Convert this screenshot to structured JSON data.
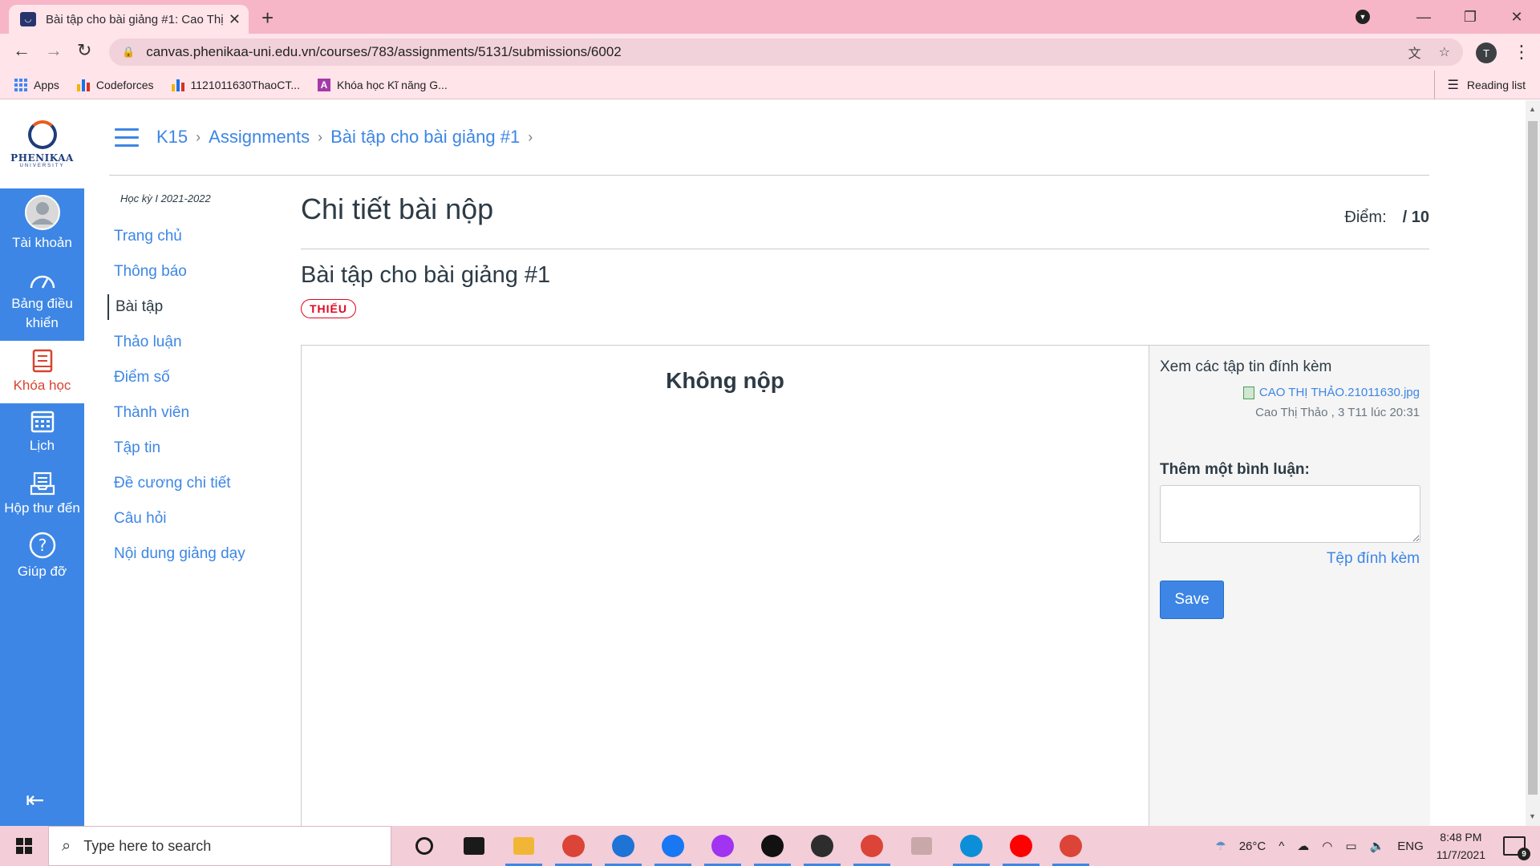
{
  "browser": {
    "tab_title": "Bài tập cho bài giảng #1: Cao Thị",
    "tab_close": "✕",
    "new_tab": "+",
    "url": "canvas.phenikaa-uni.edu.vn/courses/783/assignments/5131/submissions/6002",
    "profile_initial": "T",
    "bookmarks": [
      {
        "label": "Apps"
      },
      {
        "label": "Codeforces"
      },
      {
        "label": "1121011630ThaoCT..."
      },
      {
        "label": "Khóa học Kĩ năng G..."
      }
    ],
    "reading_list": "Reading list"
  },
  "global_nav": {
    "logo_text": "PHENIKAA",
    "logo_sub": "UNIVERSITY",
    "items": [
      {
        "label": "Tài khoản",
        "icon": "account-avatar-icon"
      },
      {
        "label": "Bảng điều khiển",
        "icon": "dashboard-gauge-icon"
      },
      {
        "label": "Khóa học",
        "icon": "courses-book-icon",
        "active": true
      },
      {
        "label": "Lịch",
        "icon": "calendar-icon"
      },
      {
        "label": "Hộp thư đến",
        "icon": "inbox-icon"
      },
      {
        "label": "Giúp đỡ",
        "icon": "help-question-icon"
      }
    ]
  },
  "breadcrumb": [
    {
      "label": "K15"
    },
    {
      "label": "Assignments"
    },
    {
      "label": "Bài tập cho bài giảng #1"
    }
  ],
  "course_nav": {
    "term": "Học kỳ I 2021-2022",
    "items": [
      {
        "label": "Trang chủ"
      },
      {
        "label": "Thông báo"
      },
      {
        "label": "Bài tập",
        "active": true
      },
      {
        "label": "Thảo luận"
      },
      {
        "label": "Điểm số"
      },
      {
        "label": "Thành viên"
      },
      {
        "label": "Tập tin"
      },
      {
        "label": "Đề cương chi tiết"
      },
      {
        "label": "Câu hỏi"
      },
      {
        "label": "Nội dung giảng dạy"
      }
    ]
  },
  "submission": {
    "page_title": "Chi tiết bài nộp",
    "score_label": "Điểm:",
    "score_value": "/ 10",
    "assignment_title": "Bài tập cho bài giảng #1",
    "status_badge": "THIẾU",
    "no_submission": "Không nộp",
    "attachments_title": "Xem các tập tin đính kèm",
    "attachment_file": "CAO THỊ THẢO.21011630.jpg",
    "attachment_meta": "Cao Thị Thảo , 3 T11 lúc 20:31",
    "comment_label": "Thêm một bình luận:",
    "attach_link": "Tệp đính kèm",
    "save_label": "Save"
  },
  "taskbar": {
    "search_placeholder": "Type here to search",
    "temperature": "26°C",
    "language": "ENG",
    "time": "8:48 PM",
    "date": "11/7/2021",
    "notification_count": "9",
    "apps": [
      {
        "icon": "cortana-icon",
        "color": "#1a1a1a"
      },
      {
        "icon": "task-view-icon",
        "color": "#1a1a1a"
      },
      {
        "icon": "file-explorer-icon",
        "color": "#f2b636"
      },
      {
        "icon": "chrome-icon",
        "color": "#db4437"
      },
      {
        "icon": "zalo-icon",
        "color": "#1d73d6"
      },
      {
        "icon": "facebook-icon",
        "color": "#1877f2"
      },
      {
        "icon": "messenger-icon",
        "color": "#a034f0"
      },
      {
        "icon": "tiktok-icon",
        "color": "#111111"
      },
      {
        "icon": "zoom-icon",
        "color": "#2d2d2d"
      },
      {
        "icon": "chrome-profile-icon",
        "color": "#db4437"
      },
      {
        "icon": "snipping-tool-icon",
        "color": "#c8a8a8"
      },
      {
        "icon": "edge-icon",
        "color": "#0c8fd8"
      },
      {
        "icon": "youtube-icon",
        "color": "#ff0000"
      },
      {
        "icon": "chrome-active-icon",
        "color": "#db4437"
      }
    ]
  }
}
